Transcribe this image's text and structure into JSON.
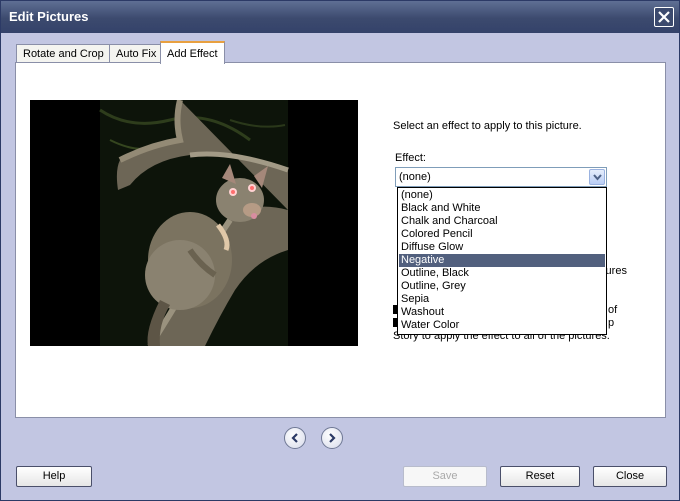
{
  "window": {
    "title": "Edit Pictures"
  },
  "tabs": [
    {
      "label": "Rotate and Crop"
    },
    {
      "label": "Auto Fix"
    },
    {
      "label": "Add Effect"
    }
  ],
  "effect_panel": {
    "instruction": "Select an effect to apply to this picture.",
    "effect_label": "Effect:",
    "selected_value": "(none)",
    "highlighted_option": "Negative",
    "options": [
      "(none)",
      "Black and White",
      "Chalk and Charcoal",
      "Colored Pencil",
      "Diffuse Glow",
      "Negative",
      "Outline, Black",
      "Outline, Grey",
      "Sepia",
      "Washout",
      "Water Color"
    ],
    "partially_hidden_text": {
      "line1": "ctures",
      "line2": "of",
      "line3": "p",
      "line4": "Story to apply the effect to all of the pictures."
    }
  },
  "buttons": {
    "help": "Help",
    "save": "Save",
    "reset": "Reset",
    "close": "Close"
  },
  "icons": {
    "close": "close-x-icon",
    "dropdown": "chevron-down-icon",
    "prev": "arrow-left-icon",
    "next": "arrow-right-icon"
  },
  "colors": {
    "title_bar": "#3c4a6e",
    "dialog_bg": "#c2c6e2",
    "highlight": "#52607e",
    "active_tab_accent": "#e8a040"
  }
}
